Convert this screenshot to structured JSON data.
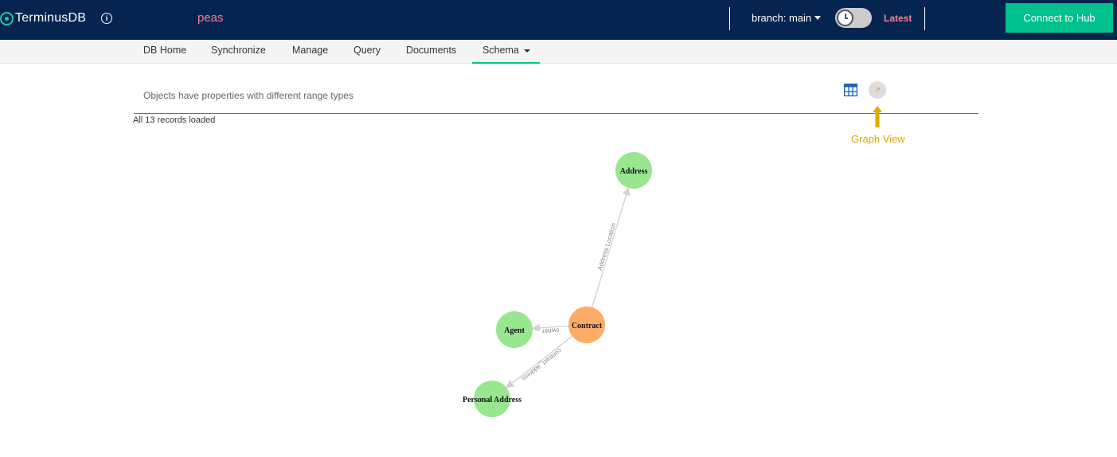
{
  "header": {
    "app_name": "TerminusDB",
    "info_icon": "info-icon",
    "db_name": "peas",
    "branch_label": "branch: main",
    "latest_label": "Latest",
    "connect_button": "Connect to Hub"
  },
  "nav": {
    "items": [
      "DB Home",
      "Synchronize",
      "Manage",
      "Query",
      "Documents",
      "Schema"
    ],
    "active": "Schema"
  },
  "schema": {
    "description": "Objects have properties with different range types",
    "records_status": "All 13 records loaded",
    "view_icons": [
      "table-view-icon",
      "graph-view-icon"
    ]
  },
  "annotation": {
    "label": "Graph View"
  },
  "graph": {
    "nodes": [
      {
        "id": "address",
        "label": "Address",
        "color": "#98e690"
      },
      {
        "id": "contract",
        "label": "Contract",
        "color": "#fdab65"
      },
      {
        "id": "agent",
        "label": "Agent",
        "color": "#98e690"
      },
      {
        "id": "personal",
        "label": "Personal Address",
        "color": "#98e690"
      }
    ],
    "edges": [
      {
        "from": "contract",
        "to": "address",
        "label": "Address Location"
      },
      {
        "from": "contract",
        "to": "agent",
        "label": "owner"
      },
      {
        "from": "contract",
        "to": "personal",
        "label": "contract_address"
      }
    ]
  },
  "colors": {
    "header_bg": "#052550",
    "accent": "#00c18b",
    "db_name": "#f67f93",
    "annotation": "#e0a800"
  }
}
